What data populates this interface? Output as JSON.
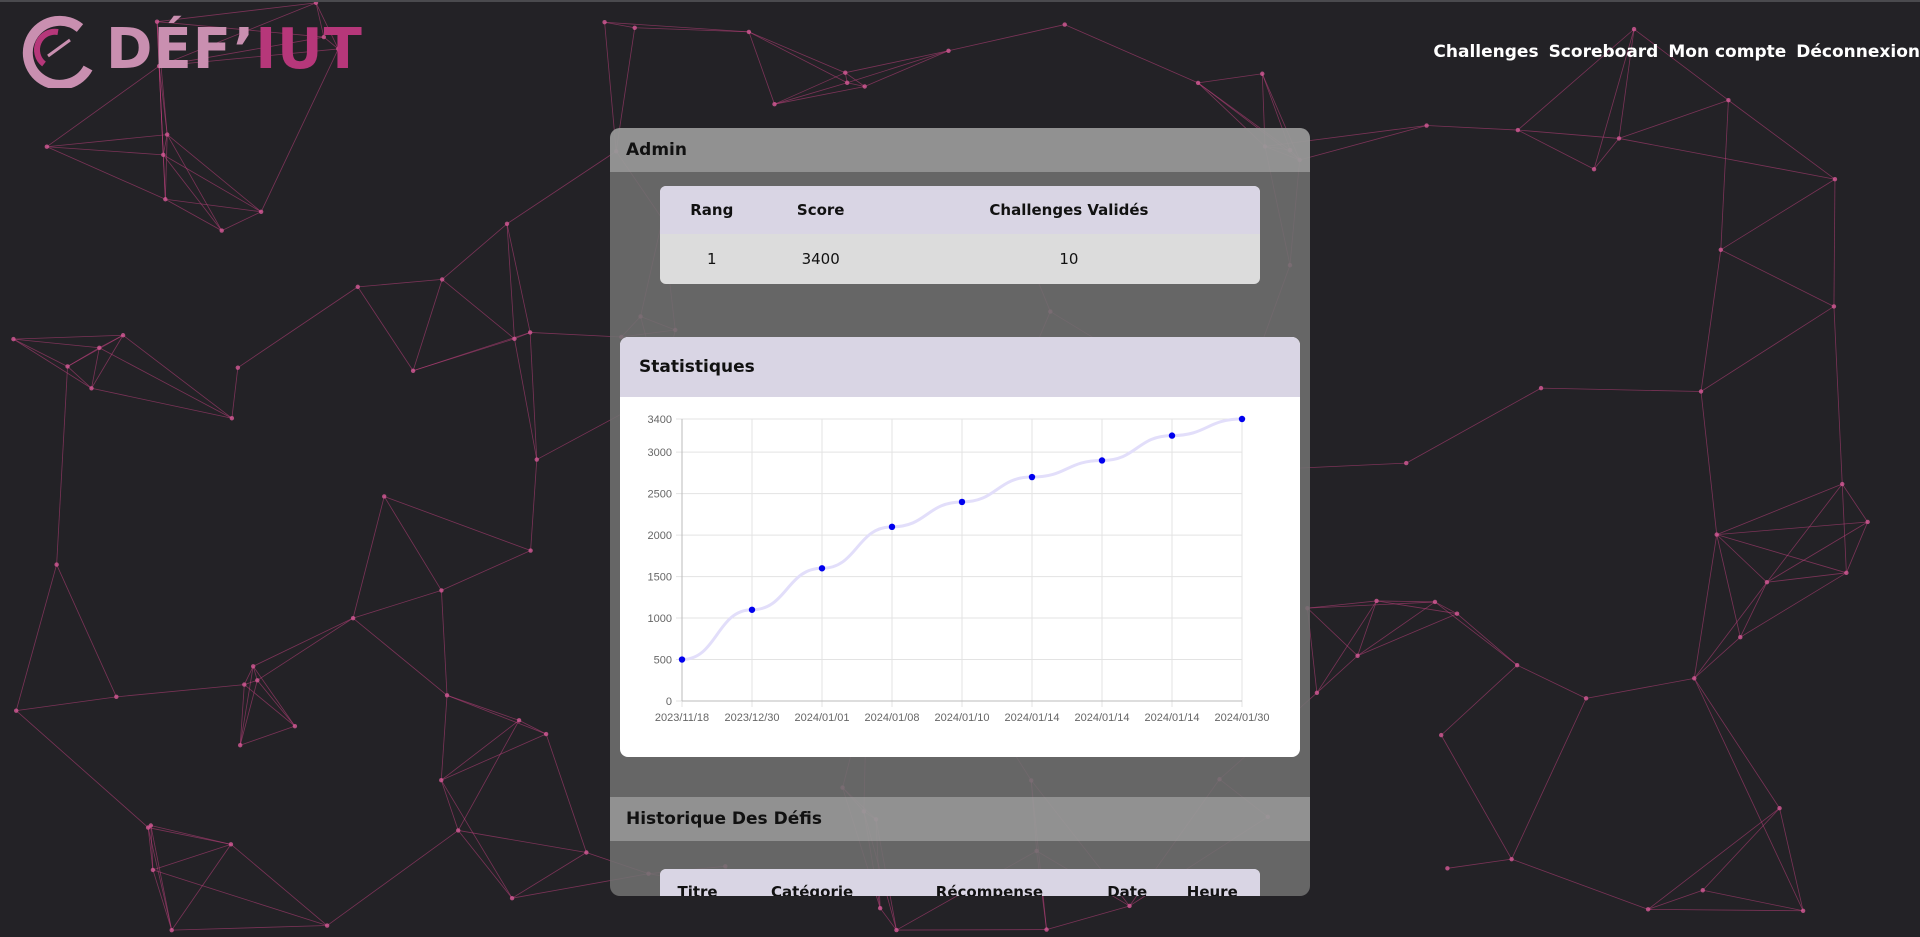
{
  "brand": {
    "logo_part1": "DÉF’",
    "logo_part2": "IUT",
    "primary": "#c98fb0",
    "accent": "#b6377a"
  },
  "nav": [
    {
      "label": "Challenges"
    },
    {
      "label": "Scoreboard"
    },
    {
      "label": "Mon compte"
    },
    {
      "label": "Déconnexion"
    }
  ],
  "profile": {
    "username": "Admin",
    "headers": [
      "Rang",
      "Score",
      "Challenges Validés"
    ],
    "values": [
      "1",
      "3400",
      "10"
    ]
  },
  "stats": {
    "title": "Statistiques"
  },
  "history": {
    "title": "Historique Des Défis",
    "headers": [
      "Titre",
      "Catégorie",
      "Récompense",
      "Date",
      "Heure"
    ]
  },
  "chart_data": {
    "type": "line",
    "categories": [
      "2023/11/18",
      "2023/12/30",
      "2024/01/01",
      "2024/01/08",
      "2024/01/10",
      "2024/01/14",
      "2024/01/14",
      "2024/01/14",
      "2024/01/30"
    ],
    "values": [
      500,
      1100,
      1600,
      2100,
      2400,
      2700,
      2900,
      3200,
      3400
    ],
    "yticks": [
      0,
      500,
      1000,
      1500,
      2000,
      2500,
      3000,
      3400
    ],
    "ylim": [
      0,
      3400
    ],
    "grid": true,
    "line_color": "#e2defa",
    "point_color": "#0000ee"
  }
}
